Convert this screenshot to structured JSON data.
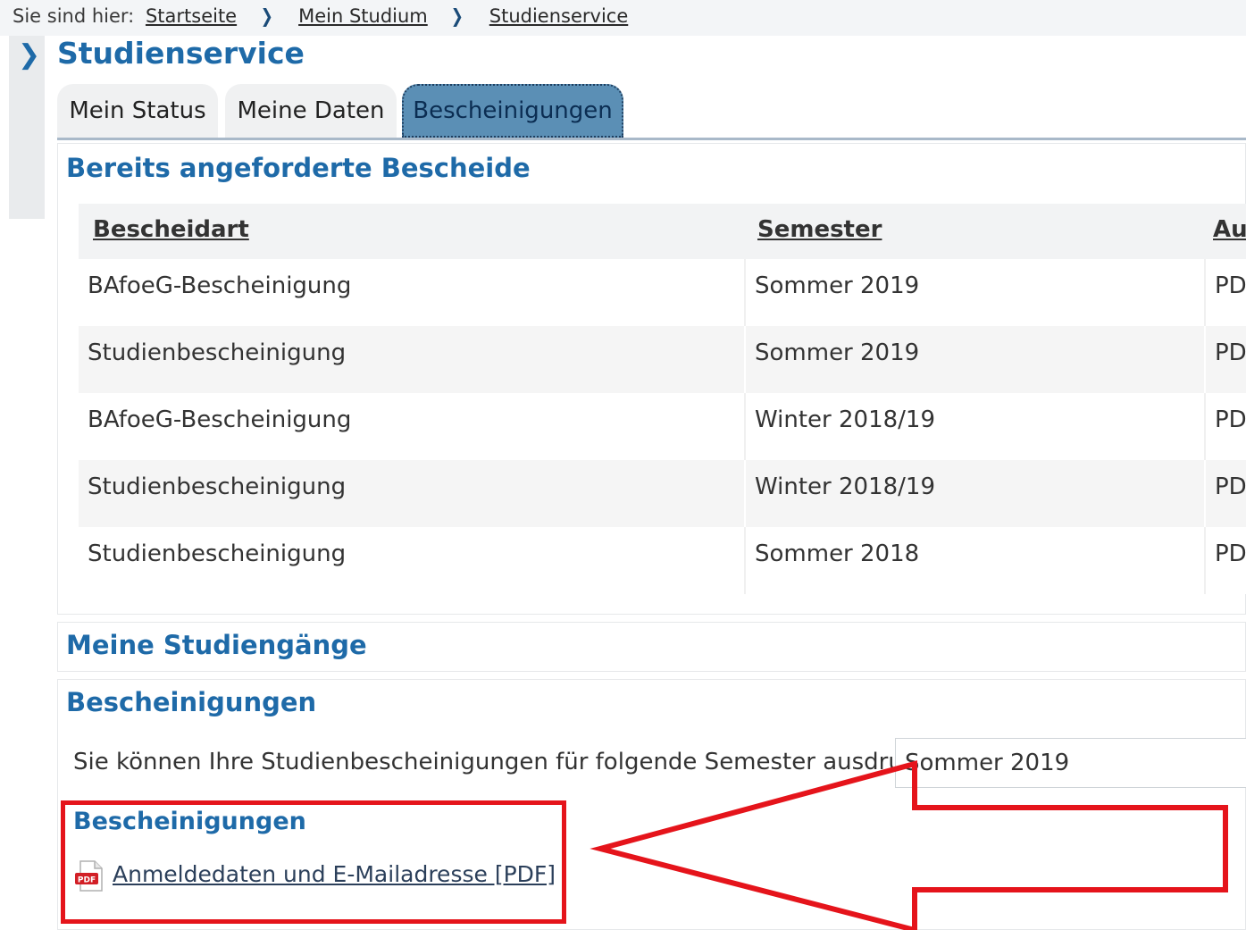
{
  "breadcrumb": {
    "prefix": "Sie sind hier:",
    "items": [
      "Startseite",
      "Mein Studium",
      "Studienservice"
    ]
  },
  "page_title": "Studienservice",
  "tabs": [
    {
      "label": "Mein Status",
      "active": false
    },
    {
      "label": "Meine Daten",
      "active": false
    },
    {
      "label": "Bescheinigungen",
      "active": true
    }
  ],
  "requested": {
    "title": "Bereits angeforderte Bescheide",
    "headers": [
      "Bescheidart",
      "Semester",
      "Aus"
    ],
    "rows": [
      [
        "BAfoeG-Bescheinigung",
        "Sommer 2019",
        "PD"
      ],
      [
        "Studienbescheinigung",
        "Sommer 2019",
        "PD"
      ],
      [
        "BAfoeG-Bescheinigung",
        "Winter 2018/19",
        "PD"
      ],
      [
        "Studienbescheinigung",
        "Winter 2018/19",
        "PD"
      ],
      [
        "Studienbescheinigung",
        "Sommer 2018",
        "PD"
      ]
    ]
  },
  "studiengaenge": {
    "title": "Meine Studiengänge"
  },
  "certificates": {
    "title": "Bescheinigungen",
    "print_text": "Sie können Ihre Studienbescheinigungen für folgende Semester ausdrucken:",
    "semester_value": "Sommer 2019",
    "sub_title": "Bescheinigungen",
    "pdf_link": "Anmeldedaten und E-Mailadresse [PDF]"
  },
  "colors": {
    "accent": "#1e6aa8",
    "active_tab": "#5b8fb5",
    "annotation_red": "#e5141b"
  }
}
